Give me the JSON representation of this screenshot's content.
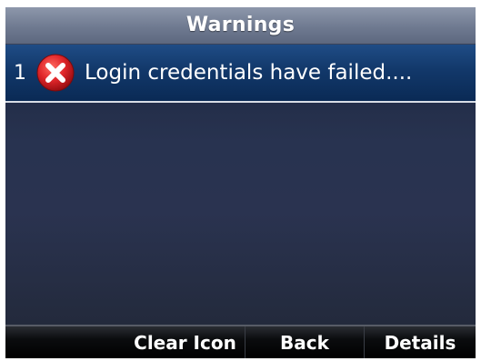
{
  "header": {
    "title": "Warnings"
  },
  "warnings": [
    {
      "index": "1",
      "icon": "error-x-icon",
      "text": "Login credentials have failed...."
    }
  ],
  "softkeys": {
    "clear_icon": "Clear Icon",
    "back": "Back",
    "details": "Details"
  },
  "colors": {
    "selected_row": "#12386a",
    "error_icon": "#e0262a",
    "title_bar": "#727d93"
  }
}
